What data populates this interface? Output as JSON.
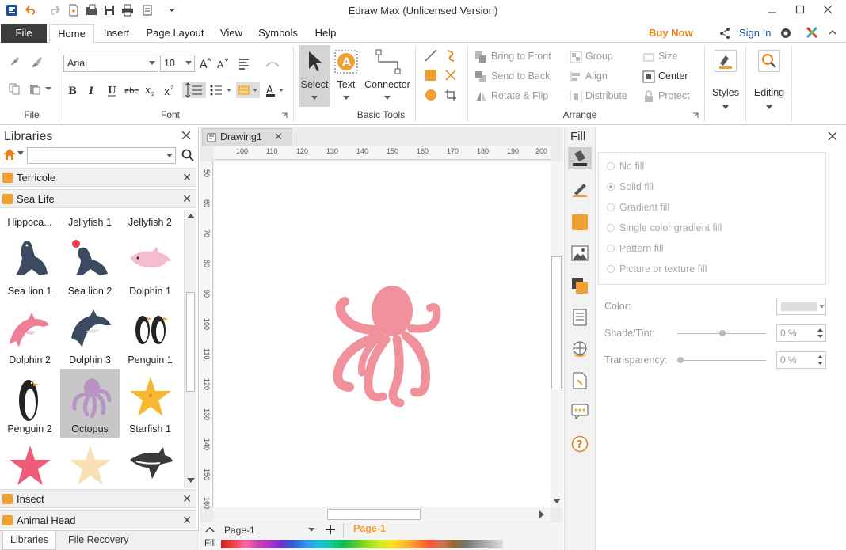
{
  "window": {
    "title": "Edraw Max (Unlicensed Version)"
  },
  "menu": {
    "tabs": [
      "File",
      "Home",
      "Insert",
      "Page Layout",
      "View",
      "Symbols",
      "Help"
    ],
    "buy_now": "Buy Now",
    "sign_in": "Sign In"
  },
  "ribbon": {
    "groups": {
      "file": "File",
      "font": "Font",
      "basic_tools": "Basic Tools",
      "arrange": "Arrange"
    },
    "font_name": "Arial",
    "font_size": "10",
    "tools": {
      "select": "Select",
      "text": "Text",
      "connector": "Connector"
    },
    "arrange": {
      "bring_to_front": "Bring to Front",
      "send_to_back": "Send to Back",
      "rotate_flip": "Rotate & Flip",
      "group": "Group",
      "align": "Align",
      "distribute": "Distribute",
      "size": "Size",
      "center": "Center",
      "protect": "Protect"
    },
    "styles": "Styles",
    "editing": "Editing"
  },
  "libraries": {
    "title": "Libraries",
    "categories": [
      "Terricole",
      "Sea Life",
      "Insect",
      "Animal Head"
    ],
    "shapes": [
      {
        "label": "Hippoca..."
      },
      {
        "label": "Jellyfish 1"
      },
      {
        "label": "Jellyfish 2"
      },
      {
        "label": "Sea lion 1"
      },
      {
        "label": "Sea lion 2"
      },
      {
        "label": "Dolphin 1"
      },
      {
        "label": "Dolphin 2"
      },
      {
        "label": "Dolphin 3"
      },
      {
        "label": "Penguin 1"
      },
      {
        "label": "Penguin 2"
      },
      {
        "label": "Octopus"
      },
      {
        "label": "Starfish 1"
      }
    ],
    "bottom_tabs": [
      "Libraries",
      "File Recovery"
    ]
  },
  "document": {
    "tab": "Drawing1",
    "ruler_h": [
      "100",
      "110",
      "120",
      "130",
      "140",
      "150",
      "160",
      "170",
      "180",
      "190",
      "200"
    ],
    "ruler_v": [
      "50",
      "60",
      "70",
      "80",
      "90",
      "100",
      "110",
      "120",
      "130",
      "140",
      "150",
      "160"
    ],
    "page_name": "Page-1",
    "page_tab": "Page-1",
    "fill_label": "Fill"
  },
  "fill_panel": {
    "title": "Fill",
    "options": [
      "No fill",
      "Solid fill",
      "Gradient fill",
      "Single color gradient fill",
      "Pattern fill",
      "Picture or texture fill"
    ],
    "color_label": "Color:",
    "shade_label": "Shade/Tint:",
    "shade_value": "0 %",
    "transparency_label": "Transparency:",
    "transparency_value": "0 %"
  },
  "colors": {
    "accent_orange": "#f0a030",
    "octopus_pink": "#f0919b",
    "octopus_purple": "#b794c4"
  }
}
